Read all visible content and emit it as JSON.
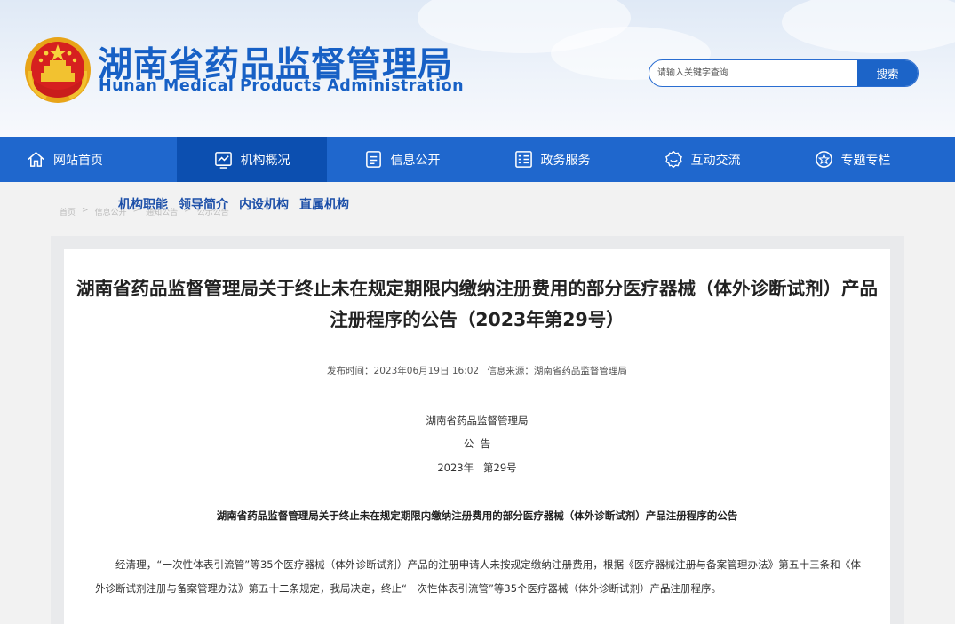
{
  "header": {
    "title": "湖南省药品监督管理局",
    "subtitle": "Hunan Medical Products Administration",
    "search": {
      "placeholder": "请输入关键字查询",
      "button_label": "搜索"
    }
  },
  "nav": {
    "items": [
      {
        "label": "网站首页",
        "icon": "home-icon"
      },
      {
        "label": "机构概况",
        "icon": "chart-icon",
        "active": true
      },
      {
        "label": "信息公开",
        "icon": "document-icon"
      },
      {
        "label": "政务服务",
        "icon": "list-icon"
      },
      {
        "label": "互动交流",
        "icon": "chat-icon"
      },
      {
        "label": "专题专栏",
        "icon": "star-icon"
      }
    ]
  },
  "subnav": {
    "items": [
      "机构职能",
      "领导简介",
      "内设机构",
      "直属机构"
    ]
  },
  "breadcrumb": {
    "items": [
      "首页",
      "信息公开",
      "通知公告",
      "公示公告"
    ]
  },
  "article": {
    "title": "湖南省药品监督管理局关于终止未在规定期限内缴纳注册费用的部分医疗器械（体外诊断试剂）产品注册程序的公告（2023年第29号）",
    "publish_time": "发布时间：2023年06月19日 16:02",
    "source": "信息来源：湖南省药品监督管理局",
    "issuer": "湖南省药品监督管理局",
    "notice_label": "公  告",
    "number": "2023年   第29号",
    "subtitle": "湖南省药品监督管理局关于终止未在规定期限内缴纳注册费用的部分医疗器械（体外诊断试剂）产品注册程序的公告",
    "body": "经清理，“一次性体表引流管”等35个医疗器械（体外诊断试剂）产品的注册申请人未按规定缴纳注册费用，根据《医疗器械注册与备案管理办法》第五十三条和《体外诊断试剂注册与备案管理办法》第五十二条规定，我局决定，终止“一次性体表引流管”等35个医疗器械（体外诊断试剂）产品注册程序。"
  },
  "colors": {
    "brand": "#1760c5",
    "nav": "#1f67cd",
    "nav_active": "#0c4fb0",
    "subnav": "#1c4fa8"
  }
}
